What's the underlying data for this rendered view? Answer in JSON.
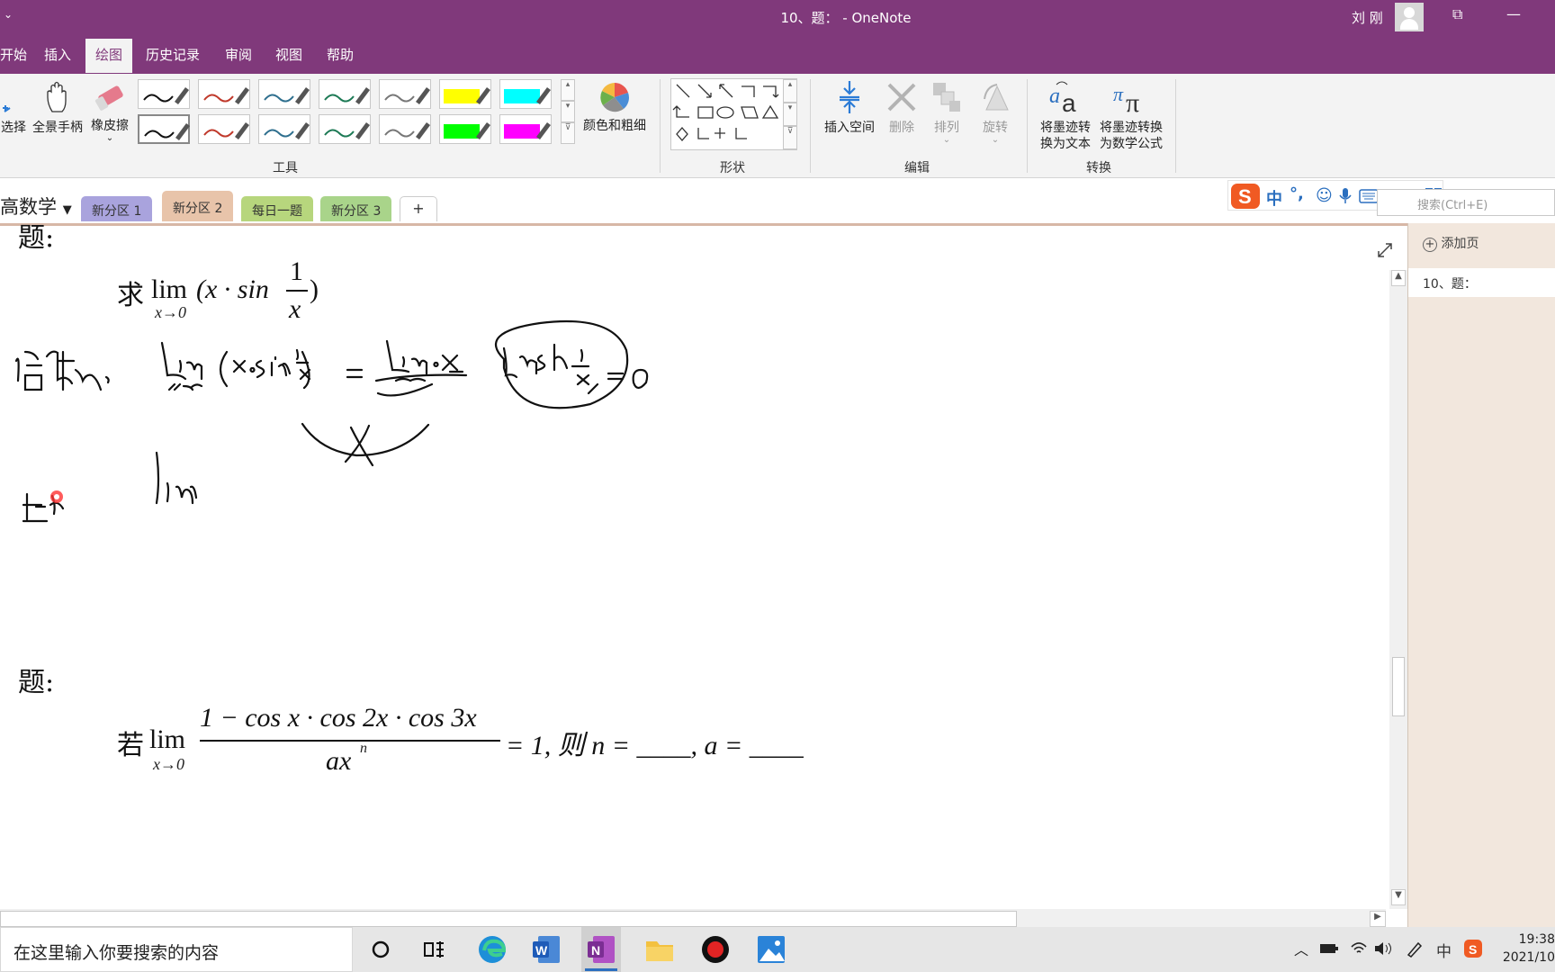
{
  "window": {
    "title": "10、题： - OneNote",
    "quick_access": "⌄",
    "user": "刘 刚",
    "btn_restore": "⧉",
    "btn_minimize": "—"
  },
  "tabs": [
    "开始",
    "插入",
    "绘图",
    "历史记录",
    "审阅",
    "视图",
    "帮助"
  ],
  "active_tab": "绘图",
  "ribbon": {
    "select": "选择",
    "pan": "全景手柄",
    "eraser": "橡皮擦",
    "color_thickness": "颜色和粗细",
    "insert_space": "插入空间",
    "delete": "删除",
    "arrange": "排列",
    "rotate": "旋转",
    "ink_to_text_1": "将墨迹转",
    "ink_to_text_2": "换为文本",
    "ink_to_math_1": "将墨迹转换",
    "ink_to_math_2": "为数学公式",
    "group_tools": "工具",
    "group_shapes": "形状",
    "group_edit": "编辑",
    "group_convert": "转换"
  },
  "pens": {
    "row1": [
      "#111111",
      "#c0392b",
      "#2e6f8e",
      "#1d7a55",
      "#777777",
      "#ffff00",
      "#00ffff"
    ],
    "row2": [
      "#111111",
      "#c0392b",
      "#2e6f8e",
      "#1d7a55",
      "#777777",
      "#00ff00",
      "#ff00ff"
    ]
  },
  "notebook": "高数学",
  "sections": [
    {
      "label": "新分区 1",
      "color": "#a9a3dd"
    },
    {
      "label": "新分区 2",
      "color": "#e8c4aa"
    },
    {
      "label": "每日一题",
      "color": "#b7d67d"
    },
    {
      "label": "新分区 3",
      "color": "#a9d48a"
    }
  ],
  "add_section": "+",
  "ime": {
    "lang": "中",
    "punct": "°,"
  },
  "search_placeholder": "搜索(Ctrl+E)",
  "page": {
    "label_q1": "题:",
    "q1_prefix": "求",
    "lim": "lim",
    "q1_sub": "x→0",
    "q1_body": "(x · sin",
    "q1_num": "1",
    "q1_den": "x",
    "q1_close": ")",
    "label_q2": "题:",
    "q2_prefix": "若",
    "q2_sub": "x→0",
    "q2_num": "1 − cos x · cos 2x · cos 3x",
    "q2_den": "ax",
    "q2_den_exp": "n",
    "q2_tail": "= 1, 则 n = ____, a = ____"
  },
  "pages_panel": {
    "add_page": "添加页",
    "page_item": "10、题："
  },
  "taskbar": {
    "search": "在这里输入你要搜索的内容",
    "time": "19:38",
    "date": "2021/10",
    "ime": "中"
  }
}
